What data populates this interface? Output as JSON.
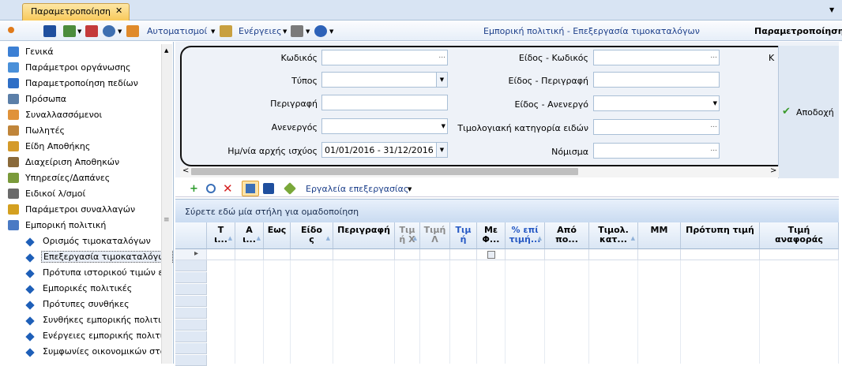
{
  "tab": {
    "title": "Παραμετροποίηση",
    "close": "✕"
  },
  "toolbar": {
    "automations_label": "Αυτοματισμοί",
    "actions_label": "Ενέργειες",
    "center_title": "Εμπορική πολιτική - Επεξεργασία τιμοκαταλόγων",
    "right_title": "Παραμετροποίηση"
  },
  "sidebar": {
    "items": [
      {
        "label": "Γενικά",
        "color": "#3b7fd4"
      },
      {
        "label": "Παράμετροι οργάνωσης",
        "color": "#4a90d9"
      },
      {
        "label": "Παραμετροποίηση πεδίων",
        "color": "#2f6fc6"
      },
      {
        "label": "Πρόσωπα",
        "color": "#5b7fa8"
      },
      {
        "label": "Συναλλασσόμενοι",
        "color": "#e0923a"
      },
      {
        "label": "Πωλητές",
        "color": "#c0853a"
      },
      {
        "label": "Είδη Αποθήκης",
        "color": "#d49a2a"
      },
      {
        "label": "Διαχείριση Αποθηκών",
        "color": "#8a6a3a"
      },
      {
        "label": "Υπηρεσίες/Δαπάνες",
        "color": "#7a9a3a"
      },
      {
        "label": "Ειδικοί λ/σμοί",
        "color": "#6a6a6a"
      },
      {
        "label": "Παράμετροι συναλλαγών",
        "color": "#d4a020"
      },
      {
        "label": "Εμπορική πολιτική",
        "color": "#4a7ac4"
      }
    ],
    "subitems": [
      {
        "label": "Ορισμός τιμοκαταλόγων",
        "selected": false
      },
      {
        "label": "Επεξεργασία τιμοκαταλόγων",
        "selected": true
      },
      {
        "label": "Πρότυπα ιστορικού τιμών ειδ",
        "selected": false
      },
      {
        "label": "Εμπορικές πολιτικές",
        "selected": false
      },
      {
        "label": "Πρότυπες συνθήκες",
        "selected": false
      },
      {
        "label": "Συνθήκες εμπορικής πολιτική",
        "selected": false
      },
      {
        "label": "Ενέργειες εμπορικής πολιτικ",
        "selected": false
      },
      {
        "label": "Συμφωνίες οικονομικών στόχ",
        "selected": false
      }
    ]
  },
  "form": {
    "code_label": "Κωδικός",
    "type_label": "Τύπος",
    "description_label": "Περιγραφή",
    "inactive_label": "Ανενεργός",
    "start_date_label": "Ημ/νία αρχής ισχύος",
    "start_date_value": "01/01/2016 - 31/12/2016",
    "item_code_label": "Είδος - Κωδικός",
    "item_description_label": "Είδος - Περιγραφή",
    "item_inactive_label": "Είδος - Ανενεργό",
    "pricing_category_label": "Τιμολογιακή κατηγορία ειδών",
    "currency_label": "Νόμισμα",
    "cut_label": "Κ",
    "ellipsis": "..."
  },
  "accept": {
    "label": "Αποδοχή"
  },
  "grid_toolbar": {
    "tools_label": "Εργαλεία επεξεργασίας"
  },
  "grid": {
    "group_hint": "Σύρετε εδώ μία στήλη για ομαδοποίηση",
    "headers": [
      {
        "l1": "Τ",
        "l2": "ι..."
      },
      {
        "l1": "Α",
        "l2": "ι..."
      },
      {
        "l1": "Εως",
        "l2": ""
      },
      {
        "l1": "Είδο",
        "l2": "ς"
      },
      {
        "l1": "Περιγραφή",
        "l2": ""
      },
      {
        "l1": "Τιμ",
        "l2": "ή Χ"
      },
      {
        "l1": "Τιμή",
        "l2": "Λ"
      },
      {
        "l1": "Τιμ",
        "l2": "ή"
      },
      {
        "l1": "Με",
        "l2": "Φ..."
      },
      {
        "l1": "% επί",
        "l2": "τιμή..."
      },
      {
        "l1": "Από",
        "l2": "πο..."
      },
      {
        "l1": "Τιμολ.",
        "l2": "κατ..."
      },
      {
        "l1": "ΜΜ",
        "l2": ""
      },
      {
        "l1": "Πρότυπη τιμή",
        "l2": ""
      },
      {
        "l1": "Τιμή",
        "l2": "αναφοράς"
      }
    ]
  }
}
